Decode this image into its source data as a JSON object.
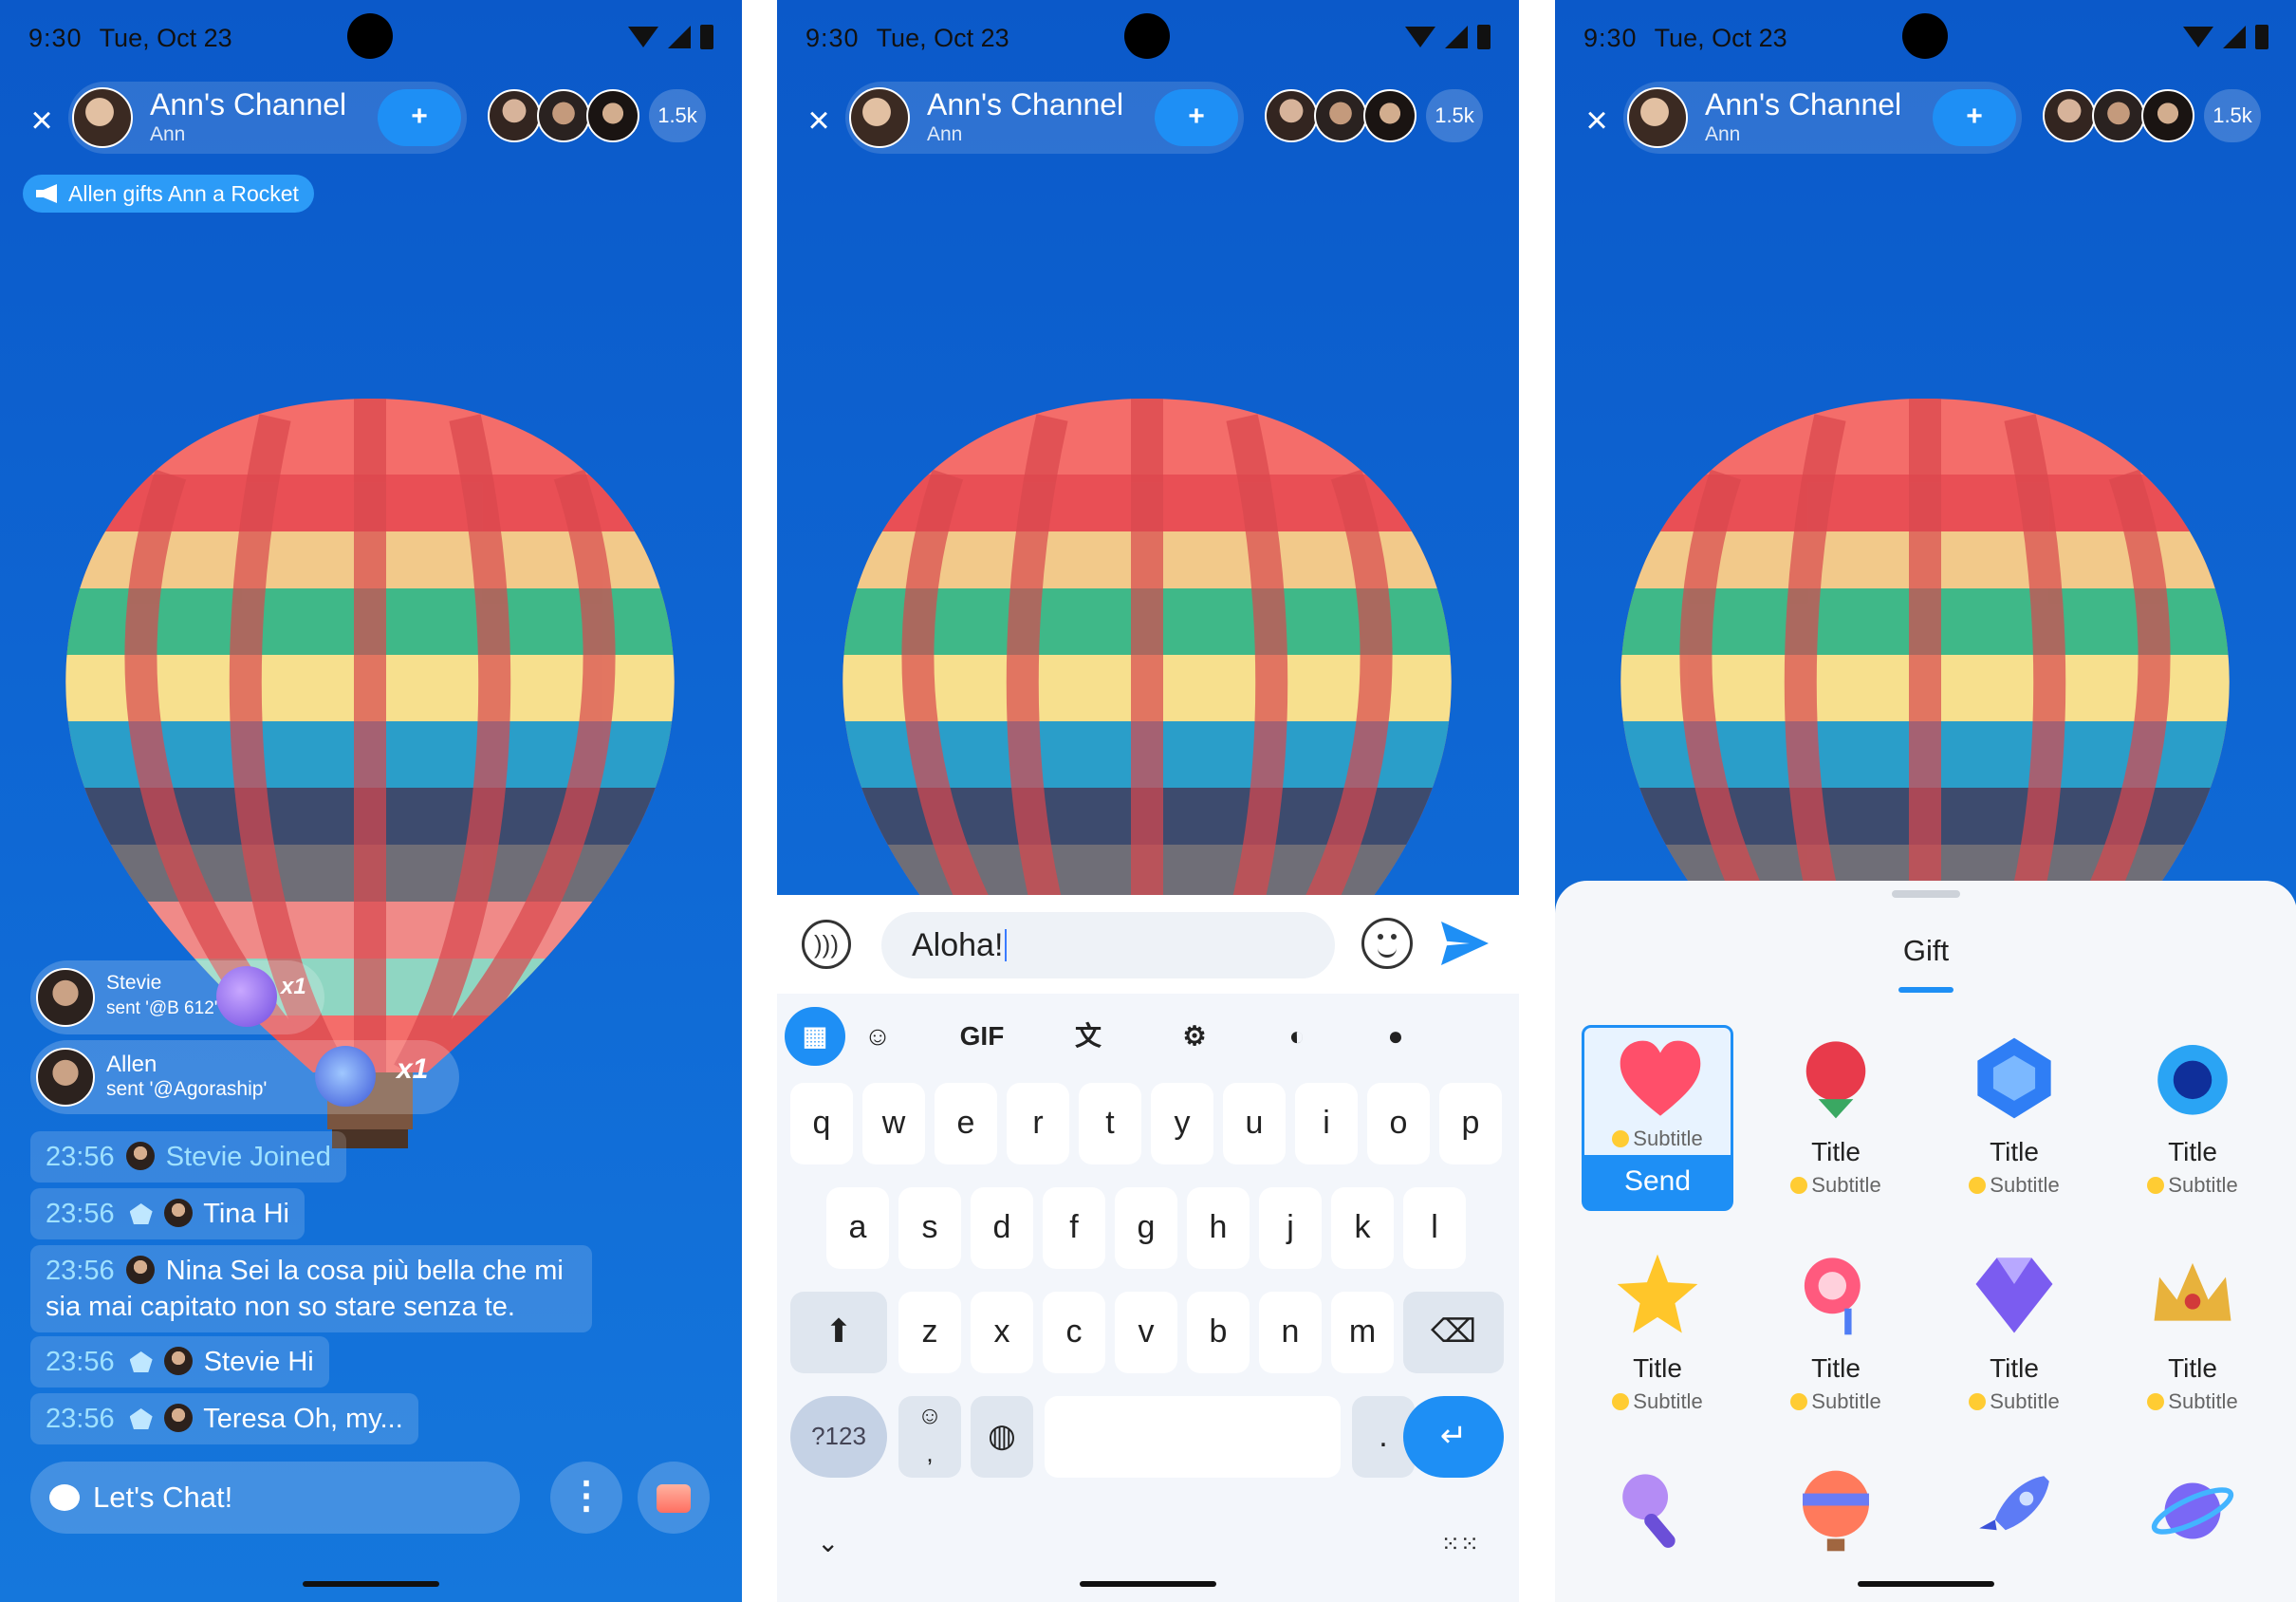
{
  "status": {
    "time": "9:30",
    "date": "Tue, Oct 23"
  },
  "channel": {
    "name": "Ann's Channel",
    "host": "Ann",
    "viewer_count": "1.5k"
  },
  "icons": {
    "close": "close-icon",
    "follow": "add-user-icon",
    "speaker": "speaker-icon",
    "voice": "voice-icon",
    "send": "send-icon"
  },
  "screen1": {
    "notice": "Allen gifts Ann a Rocket",
    "gift_cards": [
      {
        "name": "Stevie",
        "sent": "sent '@B 612'",
        "count": "x1"
      },
      {
        "name": "Allen",
        "sent": "sent '@Agoraship'",
        "count": "x1"
      }
    ],
    "messages": [
      {
        "time": "23:56",
        "text": "Stevie Joined"
      },
      {
        "time": "23:56",
        "text": "Tina Hi"
      },
      {
        "time": "23:56",
        "text": "Nina Sei la cosa più bella che mi sia mai capitato non so stare senza te."
      },
      {
        "time": "23:56",
        "text": "Stevie Hi"
      },
      {
        "time": "23:56",
        "text": "Teresa Oh, my..."
      }
    ],
    "chat_placeholder": "Let's Chat!",
    "more_label": "⋮"
  },
  "screen2": {
    "input_value": "Aloha!",
    "tools": {
      "gif": "GIF"
    },
    "keys": {
      "row1": [
        "q",
        "w",
        "e",
        "r",
        "t",
        "y",
        "u",
        "i",
        "o",
        "p"
      ],
      "row2": [
        "a",
        "s",
        "d",
        "f",
        "g",
        "h",
        "j",
        "k",
        "l"
      ],
      "row3": [
        "z",
        "x",
        "c",
        "v",
        "b",
        "n",
        "m"
      ],
      "sym": "?123",
      "period": ".",
      "comma": ","
    }
  },
  "screen3": {
    "title": "Gift",
    "send_label": "Send",
    "gifts": [
      {
        "title": "",
        "subtitle": "Subtitle",
        "icon": "heart-icon",
        "selected": true
      },
      {
        "title": "Title",
        "subtitle": "Subtitle",
        "icon": "rose-icon"
      },
      {
        "title": "Title",
        "subtitle": "Subtitle",
        "icon": "crystal-icon"
      },
      {
        "title": "Title",
        "subtitle": "Subtitle",
        "icon": "ring-icon"
      },
      {
        "title": "Title",
        "subtitle": "Subtitle",
        "icon": "star-icon"
      },
      {
        "title": "Title",
        "subtitle": "Subtitle",
        "icon": "lollipop-icon"
      },
      {
        "title": "Title",
        "subtitle": "Subtitle",
        "icon": "diamond-icon"
      },
      {
        "title": "Title",
        "subtitle": "Subtitle",
        "icon": "crown-icon"
      }
    ]
  },
  "colors": {
    "accent": "#1e8ff5",
    "background": "#0f69d5",
    "timestamp": "#9fe1ff"
  }
}
